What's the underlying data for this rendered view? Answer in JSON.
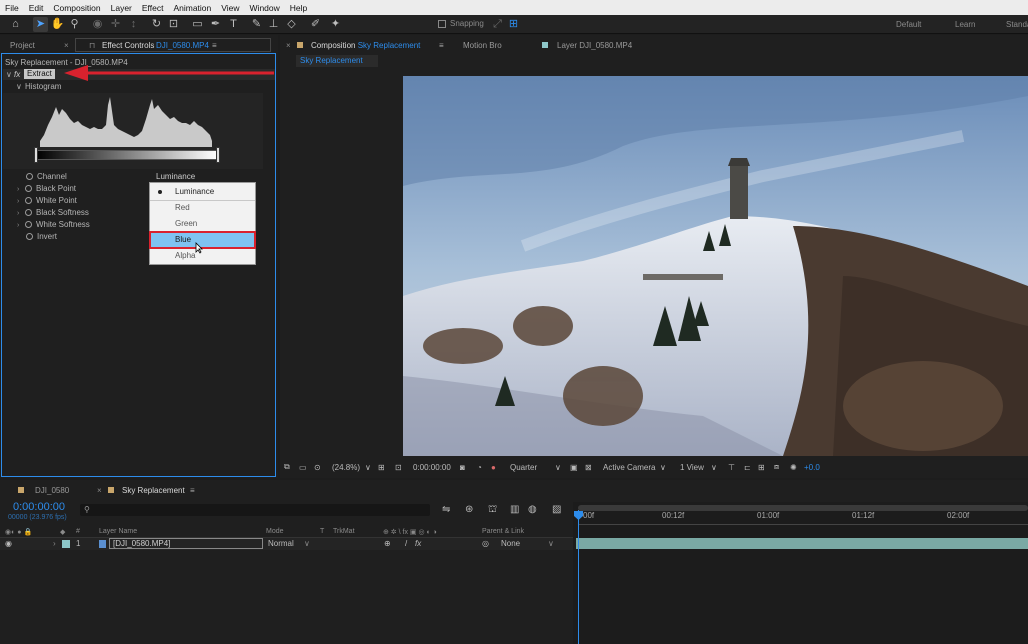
{
  "menu": [
    "File",
    "Edit",
    "Composition",
    "Layer",
    "Effect",
    "Animation",
    "View",
    "Window",
    "Help"
  ],
  "toolbar": {
    "snapping_label": "Snapping",
    "workspaces": [
      "Default",
      "Learn",
      "Standard"
    ]
  },
  "project_panel": {
    "tab_project": "Project",
    "tab_effect_controls": "Effect Controls",
    "tab_effect_controls_file": "DJI_0580.MP4",
    "breadcrumb": "Sky Replacement - DJI_0580.MP4",
    "effect": {
      "fx_label": "fx",
      "name": "Extract",
      "histogram_label": "Histogram",
      "params": [
        {
          "label": "Channel",
          "value": "Luminance"
        },
        {
          "label": "Black Point",
          "value": ""
        },
        {
          "label": "White Point",
          "value": ""
        },
        {
          "label": "Black Softness",
          "value": ""
        },
        {
          "label": "White Softness",
          "value": ""
        },
        {
          "label": "Invert",
          "value": ""
        }
      ]
    }
  },
  "channel_dropdown": {
    "items": [
      "Luminance",
      "Red",
      "Green",
      "Blue",
      "Alpha"
    ],
    "selected": "Luminance",
    "highlighted": "Blue"
  },
  "comp_panel": {
    "tab_composition_prefix": "Composition",
    "tab_composition_name": "Sky Replacement",
    "tab_motion_bro": "Motion Bro",
    "tab_layer": "Layer",
    "tab_layer_file": "DJI_0580.MP4",
    "breadcrumb": "Sky Replacement",
    "viewer_bar": {
      "zoom": "(24.8%)",
      "timecode": "0:00:00:00",
      "resolution": "Quarter",
      "camera": "Active Camera",
      "views": "1 View",
      "exposure": "+0.0"
    }
  },
  "timeline": {
    "tab_dji": "DJI_0580",
    "tab_sky": "Sky Replacement",
    "timecode": "0:00:00:00",
    "frames_fps": "00000 (23.976 fps)",
    "search_placeholder": "",
    "col_hash": "#",
    "col_layer_name": "Layer Name",
    "col_mode": "Mode",
    "col_t": "T",
    "col_trkmat": "TrkMat",
    "col_parent": "Parent & Link",
    "ruler": [
      "00f",
      "00:12f",
      "01:00f",
      "01:12f",
      "02:00f"
    ],
    "layers": [
      {
        "index": "1",
        "name": "[DJI_0580.MP4]",
        "mode": "Normal",
        "parent": "None"
      }
    ]
  },
  "colors": {
    "accent_blue": "#2d8ceb",
    "annotation_red": "#d9222e",
    "highlight": "#7fc3f1",
    "layer_bar": "#7aa9a4"
  }
}
